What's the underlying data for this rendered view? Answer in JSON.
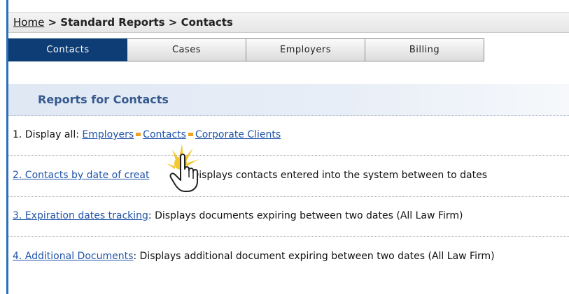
{
  "breadcrumb": {
    "home": "Home",
    "rest": " > Standard Reports > Contacts"
  },
  "tabs": [
    {
      "label": "Contacts",
      "active": true
    },
    {
      "label": "Cases",
      "active": false
    },
    {
      "label": "Employers",
      "active": false
    },
    {
      "label": "Billing",
      "active": false
    }
  ],
  "section": {
    "title": "Reports for Contacts"
  },
  "reports": {
    "r1": {
      "prefix": "1. Display all: ",
      "links": [
        "Employers",
        "Contacts",
        "Corporate Clients"
      ]
    },
    "r2": {
      "link": "2. Contacts by date of creat",
      "desc": "Displays contacts entered into the system between to dates"
    },
    "r3": {
      "link": "3. Expiration dates tracking",
      "desc": ": Displays documents expiring between two dates (All Law Firm)"
    },
    "r4": {
      "link": "4. Additional Documents",
      "desc": ": Displays additional document expiring between two dates (All Law Firm)"
    }
  },
  "colors": {
    "active_tab": "#0d3d74",
    "link": "#2255aa",
    "accent_dot": "#f0a020",
    "frame_border": "#2a6fb8"
  },
  "icons": {
    "cursor": "hand-pointer-icon"
  }
}
